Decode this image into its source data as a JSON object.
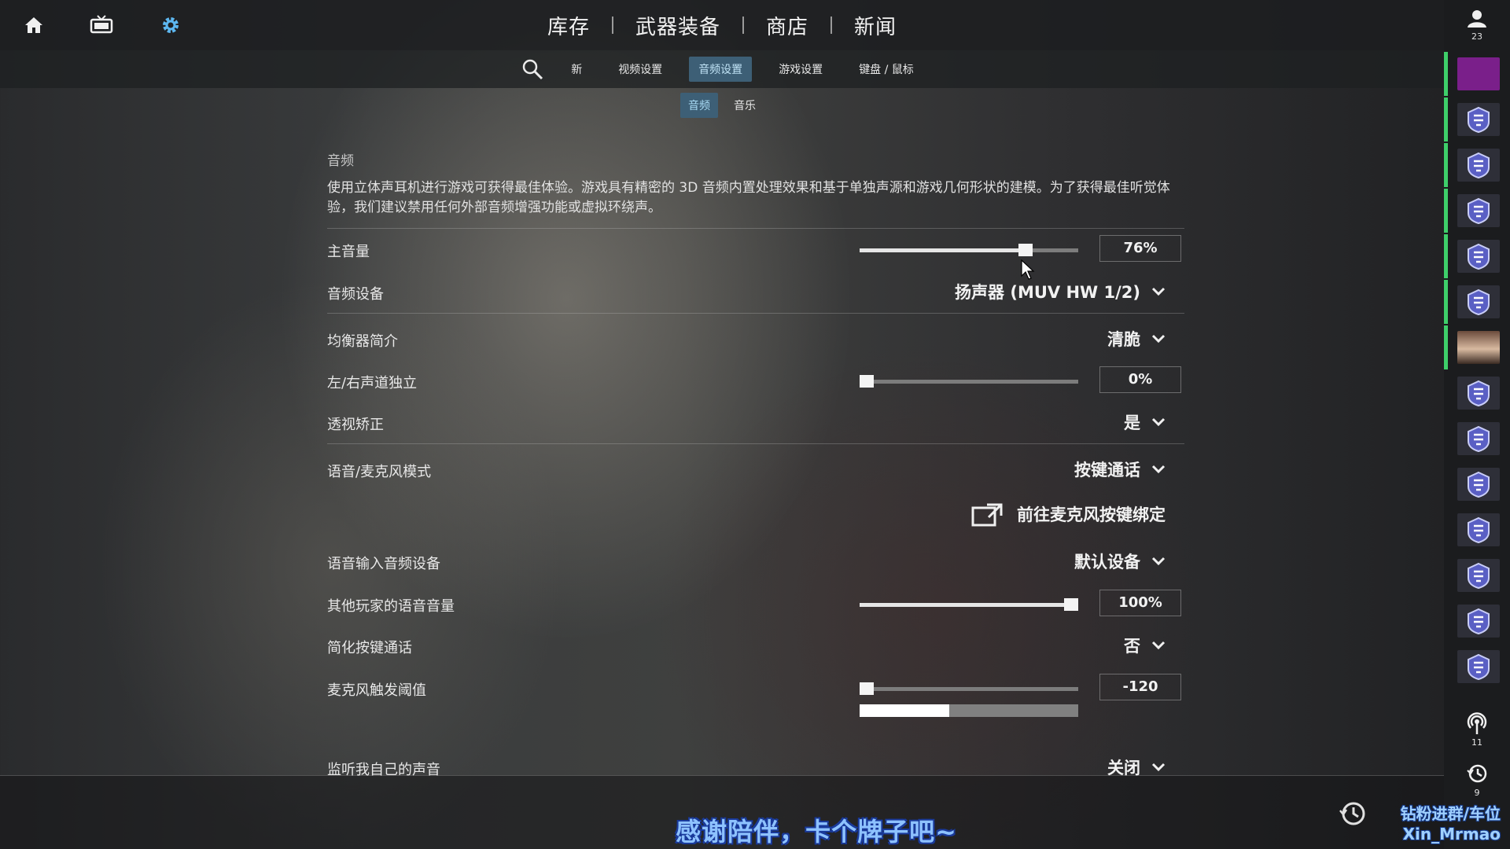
{
  "topbar": {
    "nav": [
      "库存",
      "武器装备",
      "商店",
      "新闻"
    ]
  },
  "subnav": {
    "tabs": [
      {
        "label": "新",
        "active": false
      },
      {
        "label": "视频设置",
        "active": false
      },
      {
        "label": "音频设置",
        "active": true
      },
      {
        "label": "游戏设置",
        "active": false
      },
      {
        "label": "键盘 / 鼠标",
        "active": false
      }
    ]
  },
  "subtabs": [
    {
      "label": "音频",
      "active": true
    },
    {
      "label": "音乐",
      "active": false
    }
  ],
  "section": {
    "title": "音频",
    "description": "使用立体声耳机进行游戏可获得最佳体验。游戏具有精密的 3D 音频内置处理效果和基于单独声源和游戏几何形状的建模。为了获得最佳听觉体验，我们建议禁用任何外部音频增强功能或虚拟环绕声。"
  },
  "settings": {
    "master_volume": {
      "label": "主音量",
      "value": "76%",
      "level": 0.76
    },
    "audio_device": {
      "label": "音频设备",
      "value": "扬声器 (MUV HW 1/2)"
    },
    "eq_profile": {
      "label": "均衡器简介",
      "value": "清脆"
    },
    "lr_isolation": {
      "label": "左/右声道独立",
      "value": "0%",
      "level": 0.0
    },
    "perspective": {
      "label": "透视矫正",
      "value": "是"
    },
    "voice_mode": {
      "label": "语音/麦克风模式",
      "value": "按键通话"
    },
    "ptt_binding_link": "前往麦克风按键绑定",
    "voice_input_device": {
      "label": "语音输入音频设备",
      "value": "默认设备"
    },
    "others_voice_volume": {
      "label": "其他玩家的语音音量",
      "value": "100%",
      "level": 1.0
    },
    "simplified_ptt": {
      "label": "简化按键通话",
      "value": "否"
    },
    "mic_threshold": {
      "label": "麦克风触发阈值",
      "value": "-120",
      "level": 0.0,
      "meter_level": 0.41
    },
    "monitor_own_voice": {
      "label": "监听我自己的声音",
      "value": "关闭"
    }
  },
  "rightbar": {
    "user_count": "23",
    "signal_count": "11",
    "history_count": "9"
  },
  "overlay": {
    "subtitle": "感谢陪伴，卡个牌子吧~",
    "watermark_line1": "钻粉进群/车位",
    "watermark_line2": "Xin_Mrmao"
  },
  "colors": {
    "accent_tab": "#3d5f76",
    "online_green": "#3ecf6a",
    "avatar_purple": "#7a1f8a"
  }
}
